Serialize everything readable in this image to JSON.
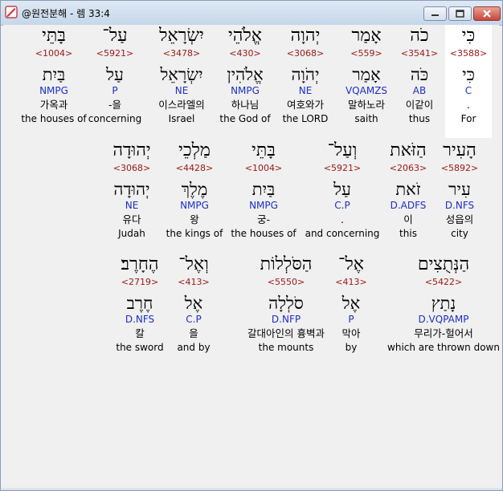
{
  "window": {
    "title": "@원전분해 - 렘 33:4"
  },
  "rows": [
    [
      {
        "heb": "כִּי",
        "strong": "<3588>",
        "lex": "כִּי",
        "morph": "C",
        "kor": ".",
        "eng": "For"
      },
      {
        "heb": "כֹה",
        "strong": "<3541>",
        "lex": "כֹּה",
        "morph": "AB",
        "kor": "이같이",
        "eng": "thus"
      },
      {
        "heb": "אָמַר",
        "strong": "<559>",
        "lex": "אָמַר",
        "morph": "VQAMZS",
        "kor": "말하노라",
        "eng": "saith"
      },
      {
        "heb": "יְהוָה",
        "strong": "<3068>",
        "lex": "יְהֹוָה",
        "morph": "NE",
        "kor": "여호와가",
        "eng": "the LORD"
      },
      {
        "heb": "אֱלֹהֵי",
        "strong": "<430>",
        "lex": "אֱלֹהִין",
        "morph": "NMPG",
        "kor": "하나님",
        "eng": "the God of"
      },
      {
        "heb": "יִשְׂרָאֵל",
        "strong": "<3478>",
        "lex": "יִשְׂרָאֵל",
        "morph": "NE",
        "kor": "이스라엘의",
        "eng": "Israel"
      },
      {
        "heb": "עַל־",
        "strong": "<5921>",
        "lex": "עַל",
        "morph": "P",
        "kor": "-을",
        "eng": "concerning"
      },
      {
        "heb": "בָּתֵּי",
        "strong": "<1004>",
        "lex": "בַּיִת",
        "morph": "NMPG",
        "kor": "가옥과",
        "eng": "the houses of"
      }
    ],
    [
      {
        "heb": "הָעִיר",
        "strong": "<5892>",
        "lex": "עִיר",
        "morph": "D.NFS",
        "kor": "성읍의",
        "eng": "city"
      },
      {
        "heb": "הַזֹּאת",
        "strong": "<2063>",
        "lex": "זֹאת",
        "morph": "D.ADFS",
        "kor": "이",
        "eng": "this"
      },
      {
        "heb": "וְעַל־",
        "strong": "<5921>",
        "lex": "עַל",
        "morph": "C.P",
        "kor": ".",
        "eng": "and concerning"
      },
      {
        "heb": "בָּתֵּי",
        "strong": "<1004>",
        "lex": "בַּיִת",
        "morph": "NMPG",
        "kor": "궁-",
        "eng": "the houses of"
      },
      {
        "heb": "מַלְכֵי",
        "strong": "<4428>",
        "lex": "מֶלֶךְ",
        "morph": "NMPG",
        "kor": "왕",
        "eng": "the kings of"
      },
      {
        "heb": "יְהוּדָה",
        "strong": "<3068>",
        "lex": "יְהוּדָה",
        "morph": "NE",
        "kor": "유다",
        "eng": "Judah"
      }
    ],
    [
      {
        "heb": "הַנְּתֻצִים",
        "strong": "<5422>",
        "lex": "נָתַץ",
        "morph": "D.VQPAMP",
        "kor": "무리가-헐어서",
        "eng": "which are thrown down"
      },
      {
        "heb": "אֶל־",
        "strong": "<413>",
        "lex": "אֶל",
        "morph": "P",
        "kor": "막아",
        "eng": "by"
      },
      {
        "heb": "הַסֹּלְלוֹת",
        "strong": "<5550>",
        "lex": "סֹלְלָה",
        "morph": "D.NFP",
        "kor": "갈대아인의 흉벽과",
        "eng": "the mounts"
      },
      {
        "heb": "וְאֶל־",
        "strong": "<413>",
        "lex": "אֶל",
        "morph": "C.P",
        "kor": "을",
        "eng": "and by"
      },
      {
        "heb": "הֶחָרֶב׃",
        "strong": "<2719>",
        "lex": "חֶרֶב",
        "morph": "D.NFS",
        "kor": "칼",
        "eng": "the sword"
      }
    ]
  ]
}
